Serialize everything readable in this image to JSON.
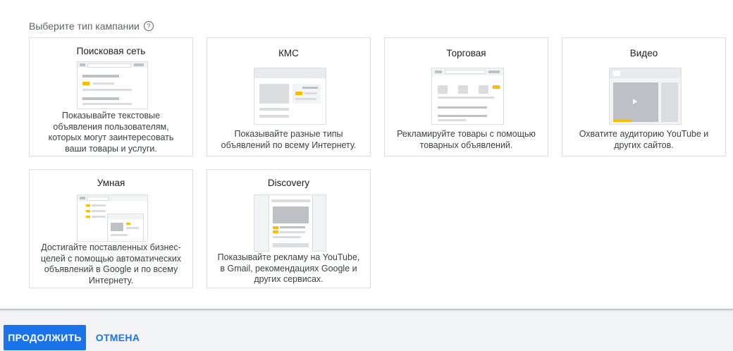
{
  "heading": "Выберите тип кампании",
  "help_icon": "help-circle-icon",
  "cards": [
    {
      "title": "Поисковая сеть",
      "lines": [
        "Показывайте текстовые",
        "объявления пользователям,",
        "которых могут заинтересовать",
        "ваши товары и услуги."
      ]
    },
    {
      "title": "КМС",
      "lines": [
        "Показывайте разные типы",
        "объявлений по всему Интернету."
      ]
    },
    {
      "title": "Торговая",
      "lines": [
        "Рекламируйте товары с помощью",
        "товарных объявлений."
      ]
    },
    {
      "title": "Видео",
      "lines": [
        "Охватите аудиторию YouTube и",
        "других сайтов."
      ]
    },
    {
      "title": "Умная",
      "lines": [
        "Достигайте поставленных бизнес-",
        "целей с помощью автоматических",
        "объявлений в Google и по всему",
        "Интернету."
      ]
    },
    {
      "title": "Discovery",
      "lines": [
        "Показывайте рекламу на YouTube,",
        "в Gmail, рекомендациях Google и",
        "других сервисах."
      ]
    }
  ],
  "buttons": {
    "continue": "ПРОДОЛЖИТЬ",
    "cancel": "ОТМЕНА"
  },
  "colors": {
    "accent": "#1a73e8",
    "highlight": "#fbbc04",
    "border": "#dadce0"
  }
}
